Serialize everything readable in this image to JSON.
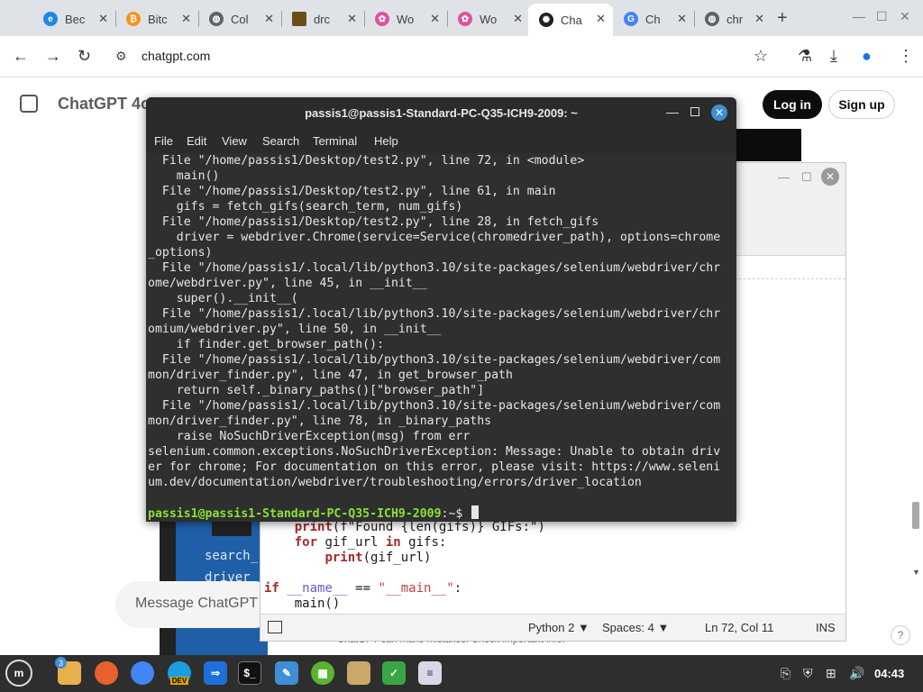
{
  "browser": {
    "tabs": [
      {
        "title": "Bec",
        "favicon": "edge-icon",
        "color": "#1e88e5"
      },
      {
        "title": "Bitc",
        "favicon": "bitcoin-icon",
        "color": "#f7931a"
      },
      {
        "title": "Col",
        "favicon": "web-icon",
        "color": "#5f6368"
      },
      {
        "title": "drc",
        "favicon": "image-icon",
        "color": "#6b4e16"
      },
      {
        "title": "Wo",
        "favicon": "flower-icon",
        "color": "#e0529c"
      },
      {
        "title": "Wo",
        "favicon": "flower-icon",
        "color": "#e0529c"
      },
      {
        "title": "Cha",
        "favicon": "chatgpt-icon",
        "color": "#202124"
      },
      {
        "title": "Ch",
        "favicon": "google-icon",
        "color": "#4285f4"
      },
      {
        "title": "chr",
        "favicon": "web-icon",
        "color": "#5f6368"
      }
    ],
    "url": "chatgpt.com"
  },
  "chatgpt": {
    "model": "ChatGPT 4o",
    "login": "Log in",
    "signup": "Sign up",
    "message_placeholder": "Message ChatGPT",
    "disclaimer": "ChatGPT can make mistakes. Check important info.",
    "help": "?",
    "code_preview": [
      "search_",
      "driver_"
    ]
  },
  "editor": {
    "code": {
      "line1_kw": "print",
      "line1_rest": "(f\"Found {len(gifs)} GIFs:\")",
      "line2_for": "for",
      "line2_mid": " gif_url ",
      "line2_in": "in",
      "line2_end": " gifs:",
      "line3_print": "print",
      "line3_rest": "(gif_url)",
      "line4_if": "if",
      "line4_name": "__name__",
      "line4_eq": " == ",
      "line4_main": "\"__main__\"",
      "line4_colon": ":",
      "line5": "main()"
    },
    "status": {
      "language": "Python 2",
      "spaces": "Spaces: 4",
      "position": "Ln 72, Col 11",
      "mode": "INS"
    }
  },
  "terminal": {
    "title": "passis1@passis1-Standard-PC-Q35-ICH9-2009: ~",
    "menu": [
      "File",
      "Edit",
      "View",
      "Search",
      "Terminal",
      "Help"
    ],
    "lines": [
      "  File \"/home/passis1/Desktop/test2.py\", line 72, in <module>",
      "    main()",
      "  File \"/home/passis1/Desktop/test2.py\", line 61, in main",
      "    gifs = fetch_gifs(search_term, num_gifs)",
      "  File \"/home/passis1/Desktop/test2.py\", line 28, in fetch_gifs",
      "    driver = webdriver.Chrome(service=Service(chromedriver_path), options=chrome",
      "_options)",
      "  File \"/home/passis1/.local/lib/python3.10/site-packages/selenium/webdriver/chr",
      "ome/webdriver.py\", line 45, in __init__",
      "    super().__init__(",
      "  File \"/home/passis1/.local/lib/python3.10/site-packages/selenium/webdriver/chr",
      "omium/webdriver.py\", line 50, in __init__",
      "    if finder.get_browser_path():",
      "  File \"/home/passis1/.local/lib/python3.10/site-packages/selenium/webdriver/com",
      "mon/driver_finder.py\", line 47, in get_browser_path",
      "    return self._binary_paths()[\"browser_path\"]",
      "  File \"/home/passis1/.local/lib/python3.10/site-packages/selenium/webdriver/com",
      "mon/driver_finder.py\", line 78, in _binary_paths",
      "    raise NoSuchDriverException(msg) from err",
      "selenium.common.exceptions.NoSuchDriverException: Message: Unable to obtain driv",
      "er for chrome; For documentation on this error, please visit: https://www.seleni",
      "um.dev/documentation/webdriver/troubleshooting/errors/driver_location"
    ],
    "prompt_user": "passis1@passis1-Standard-PC-Q35-ICH9-2009",
    "prompt_path": ":~$"
  },
  "taskbar": {
    "badge_count": "3",
    "clock": "04:43",
    "dev_label": "DEV"
  }
}
